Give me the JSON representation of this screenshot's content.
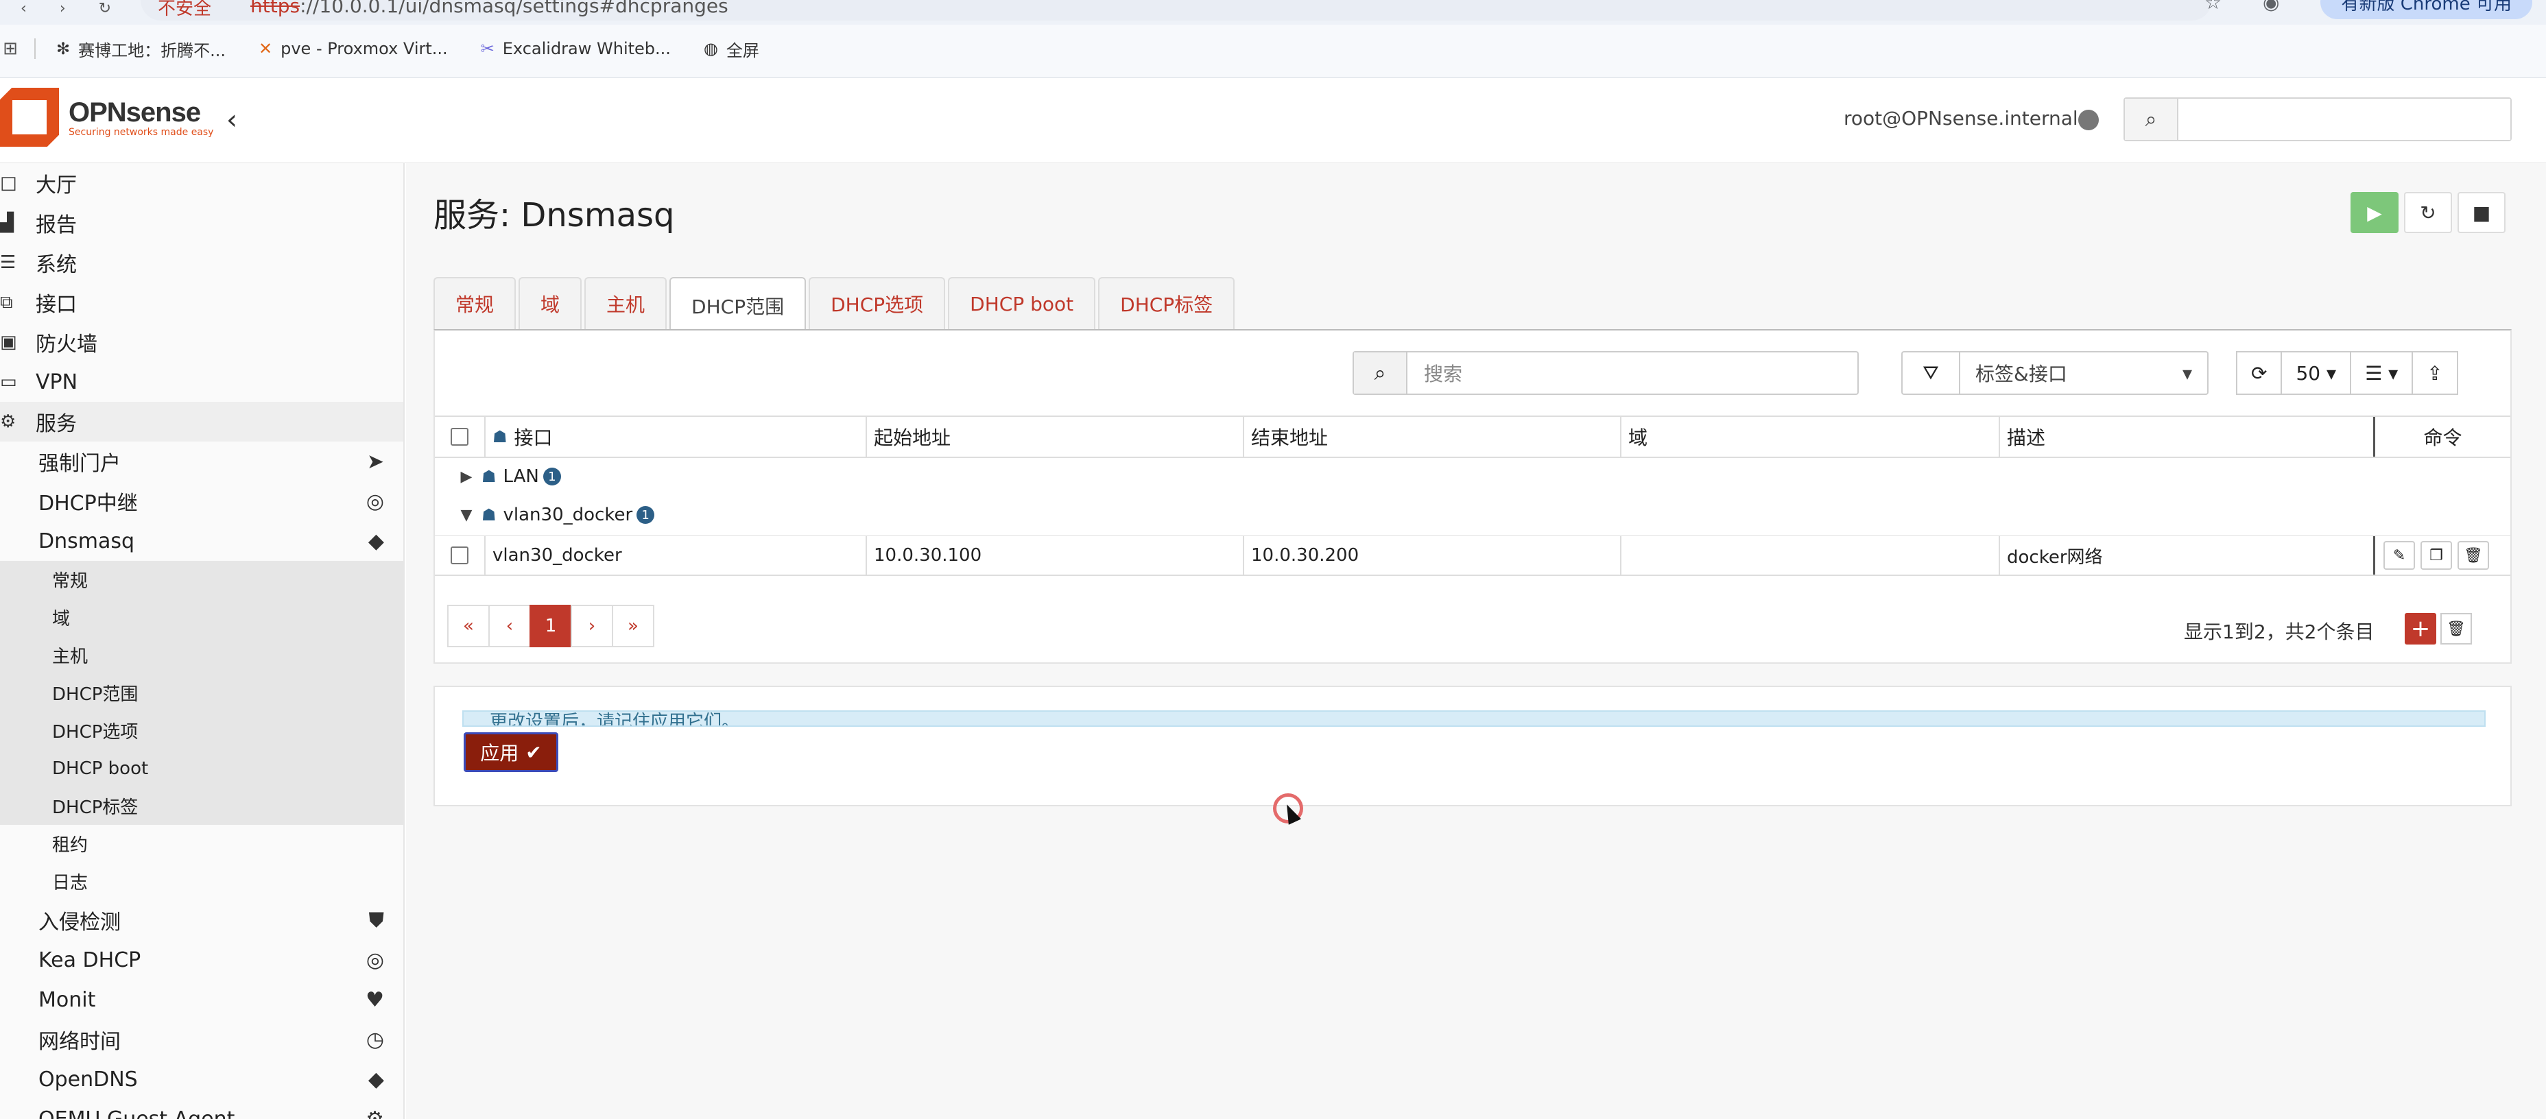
{
  "browser": {
    "warning": "不安全",
    "url_scheme": "https",
    "url_rest": "://10.0.0.1/ui/dnsmasq/settings#dhcpranges",
    "update_label": "有新版 Chrome 可用",
    "bookmarks": [
      {
        "label": "赛博工地：折腾不...",
        "icon": "✻"
      },
      {
        "label": "pve - Proxmox Virt...",
        "icon": "✕"
      },
      {
        "label": "Excalidraw Whiteb...",
        "icon": "✂"
      },
      {
        "label": "全屏",
        "icon": "◍"
      }
    ]
  },
  "header": {
    "logo_name": "OPNsense",
    "logo_tagline": "Securing networks made easy",
    "user": "root@OPNsense.internal",
    "search_placeholder": ""
  },
  "sidebar": {
    "top_items": [
      {
        "label": "大厅",
        "icon": "□"
      },
      {
        "label": "报告",
        "icon": "▟"
      },
      {
        "label": "系统",
        "icon": "☰"
      },
      {
        "label": "接口",
        "icon": "⧉"
      },
      {
        "label": "防火墙",
        "icon": "▣"
      },
      {
        "label": "VPN",
        "icon": "▭"
      },
      {
        "label": "服务",
        "icon": "⚙"
      }
    ],
    "service_items": [
      {
        "label": "强制门户",
        "icon": "➤"
      },
      {
        "label": "DHCP中继",
        "icon": "◎"
      },
      {
        "label": "Dnsmasq",
        "icon": "◆"
      }
    ],
    "dnsmasq_items": [
      "常规",
      "域",
      "主机",
      "DHCP范围",
      "DHCP选项",
      "DHCP boot",
      "DHCP标签"
    ],
    "extra_dnsmasq_items": [
      "租约",
      "日志"
    ],
    "more_items": [
      {
        "label": "入侵检测",
        "icon": "⛊"
      },
      {
        "label": "Kea DHCP",
        "icon": "◎"
      },
      {
        "label": "Monit",
        "icon": "♥"
      },
      {
        "label": "网络时间",
        "icon": "◷"
      },
      {
        "label": "OpenDNS",
        "icon": "◆"
      },
      {
        "label": "QEMU Guest Agent",
        "icon": "⚙"
      }
    ]
  },
  "page": {
    "title": "服务: Dnsmasq",
    "tabs": [
      "常规",
      "域",
      "主机",
      "DHCP范围",
      "DHCP选项",
      "DHCP boot",
      "DHCP标签"
    ],
    "active_tab": 3,
    "search_placeholder": "搜索",
    "filter_label": "标签&接口",
    "page_size": "50",
    "columns": [
      "接口",
      "起始地址",
      "结束地址",
      "域",
      "描述",
      "命令"
    ],
    "groups": [
      {
        "name": "LAN",
        "badge": "1",
        "expanded": false
      },
      {
        "name": "vlan30_docker",
        "badge": "1",
        "expanded": true
      }
    ],
    "rows": [
      {
        "interface": "vlan30_docker",
        "start": "10.0.30.100",
        "end": "10.0.30.200",
        "domain": "",
        "description": "docker网络"
      }
    ],
    "pager": [
      "«",
      "‹",
      "1",
      "›",
      "»"
    ],
    "pager_info": "显示1到2，共2个条目",
    "alert_text": "更改设置后，请记住应用它们。",
    "apply_label": "应用"
  }
}
